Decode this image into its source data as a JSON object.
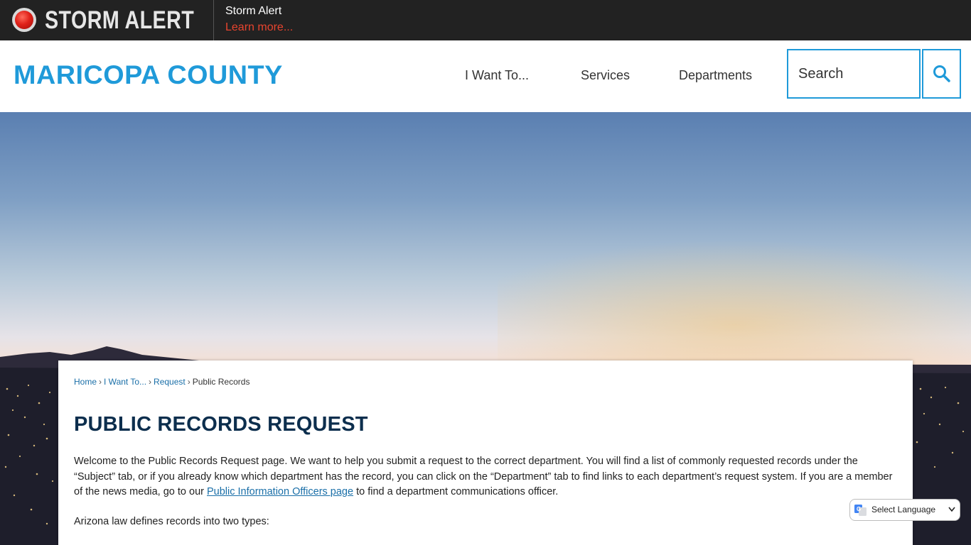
{
  "alert": {
    "brand": "STORM ALERT",
    "title": "Storm Alert",
    "link": "Learn more..."
  },
  "header": {
    "logo": "MARICOPA COUNTY",
    "nav": [
      "I Want To...",
      "Services",
      "Departments"
    ],
    "search_placeholder": "Search"
  },
  "breadcrumb": {
    "items": [
      "Home",
      "I Want To...",
      "Request"
    ],
    "current": "Public Records",
    "separator": "›"
  },
  "page": {
    "title": "PUBLIC RECORDS REQUEST",
    "intro_before": "Welcome to the Public Records Request page. We want to help you submit a request to the correct department. You will find a list of commonly requested records under the “Subject” tab, or if you already know which department has the record, you can click on the “Department” tab to find links to each department’s request system. If you are a member of the news media, go to our ",
    "intro_link": "Public Information Officers page",
    "intro_after": " to find a department communications officer.",
    "law_text": "Arizona law defines records into two types:"
  },
  "translate": {
    "label": "Select Language"
  },
  "colors": {
    "alert_bg": "#222222",
    "alert_link": "#e8442e",
    "brand_blue": "#1f9ad9",
    "title_navy": "#0c2e4d",
    "link_blue": "#1a6fa8"
  },
  "icons": [
    "alert-light-icon",
    "search-icon",
    "google-translate-icon",
    "chevron-down-icon"
  ]
}
